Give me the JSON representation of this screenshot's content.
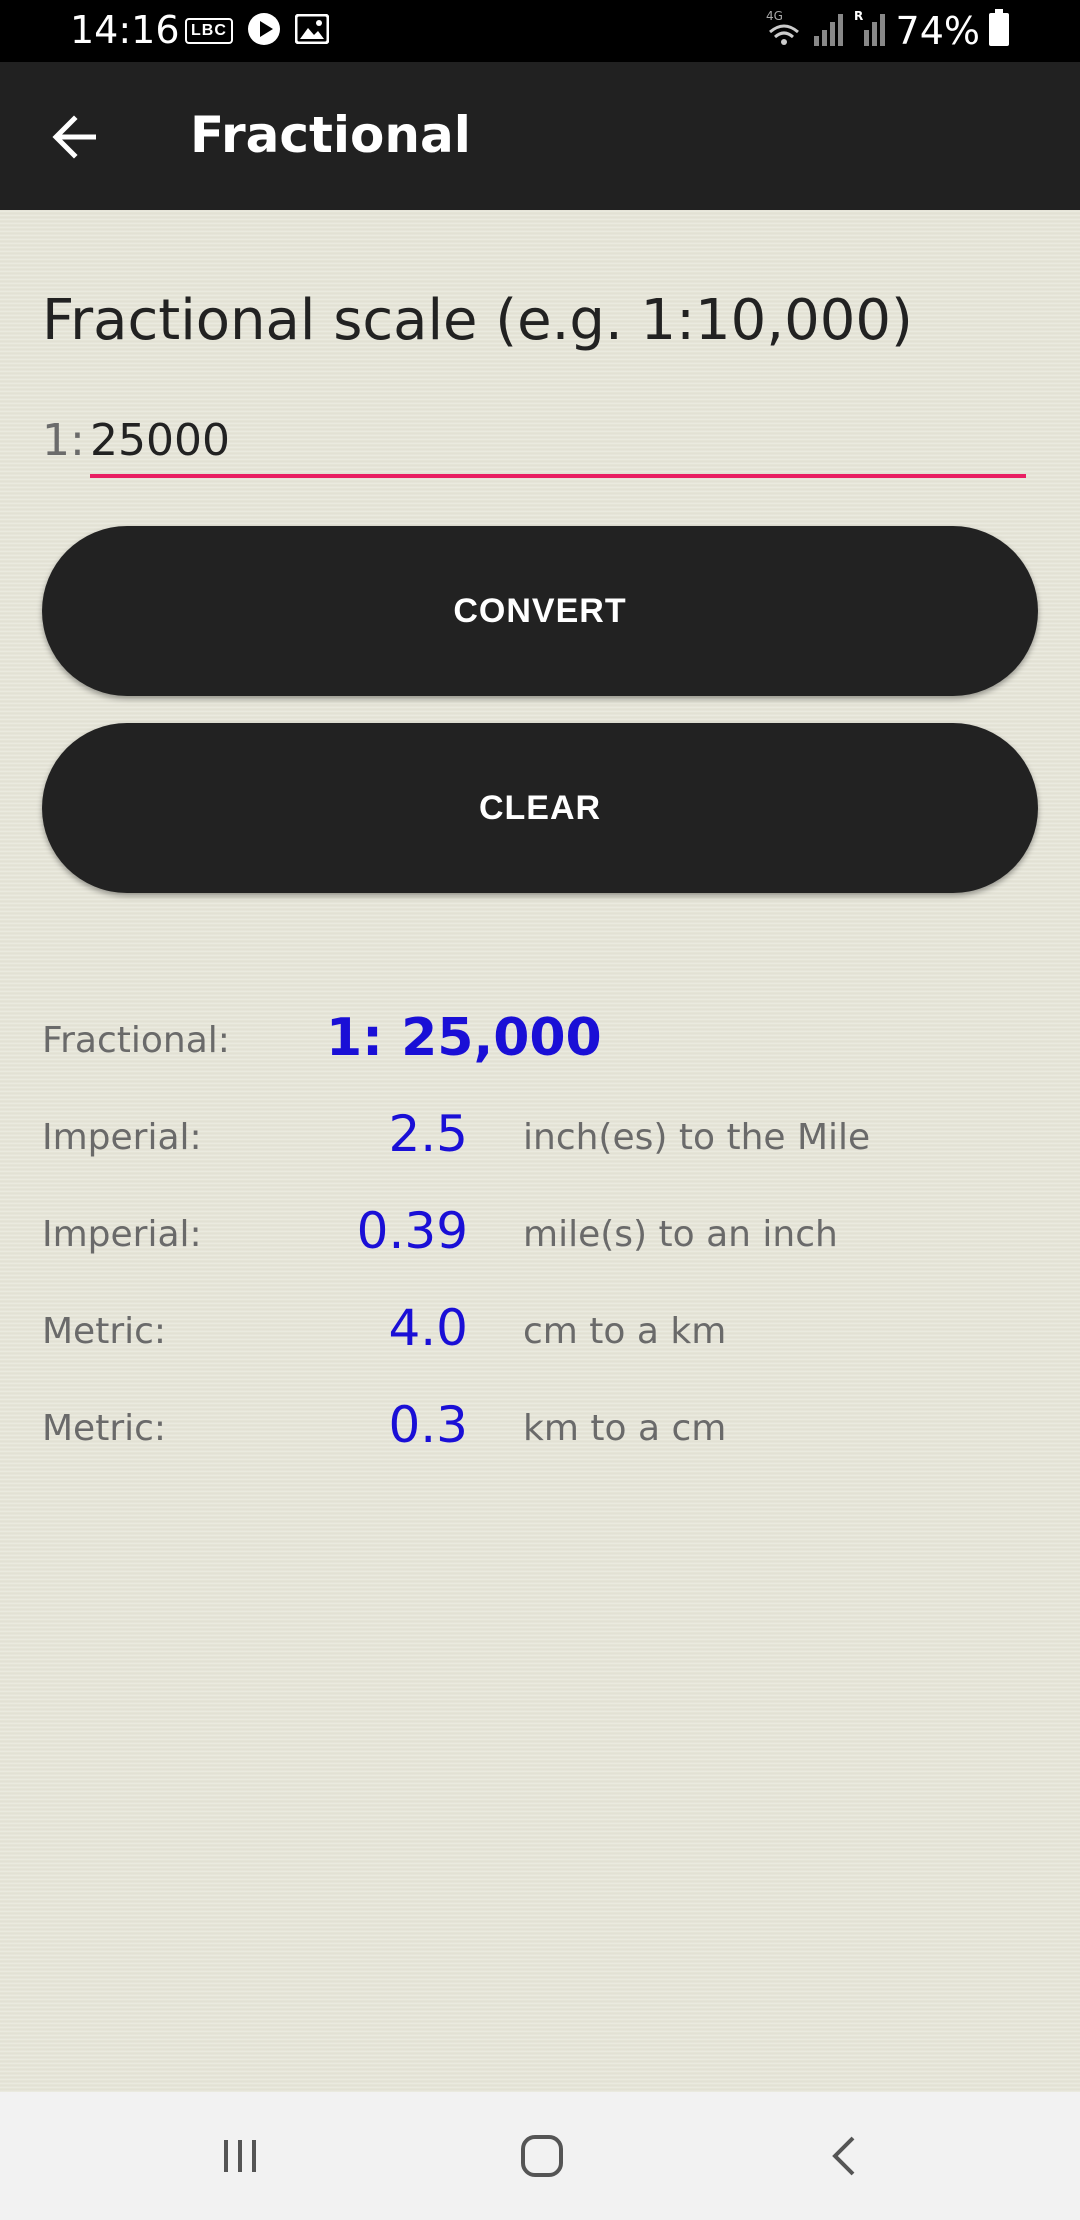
{
  "status_bar": {
    "time": "14:16",
    "battery": "74%",
    "icons": [
      "lbc-icon",
      "play-icon",
      "image-icon",
      "wifi-icon",
      "signal-icon",
      "signal-roaming-icon",
      "battery-icon"
    ],
    "lbc_label": "LBC",
    "network_label": "4G"
  },
  "app_bar": {
    "title": "Fractional",
    "back_icon": "arrow-left-icon"
  },
  "form": {
    "prompt": "Fractional scale (e.g. 1:10,000)",
    "prefix": "1:",
    "input_value": "25000",
    "convert_label": "CONVERT",
    "clear_label": "CLEAR"
  },
  "results": {
    "fractional": {
      "label": "Fractional:",
      "value": "1: 25,000"
    },
    "rows": [
      {
        "label": "Imperial:",
        "value": "2.5",
        "unit": "inch(es) to the Mile"
      },
      {
        "label": "Imperial:",
        "value": "0.39",
        "unit": "mile(s) to an inch"
      },
      {
        "label": "Metric:",
        "value": "4.0",
        "unit": "cm to a km"
      },
      {
        "label": "Metric:",
        "value": "0.3",
        "unit": "km to a cm"
      }
    ]
  },
  "colors": {
    "accent": "#e91e63",
    "result_value": "#1a0fd6",
    "app_bar": "#212121",
    "button": "#222222",
    "background": "#e6e5d8"
  },
  "nav_bar": {
    "icons": [
      "recent-apps-icon",
      "home-icon",
      "back-icon"
    ]
  }
}
